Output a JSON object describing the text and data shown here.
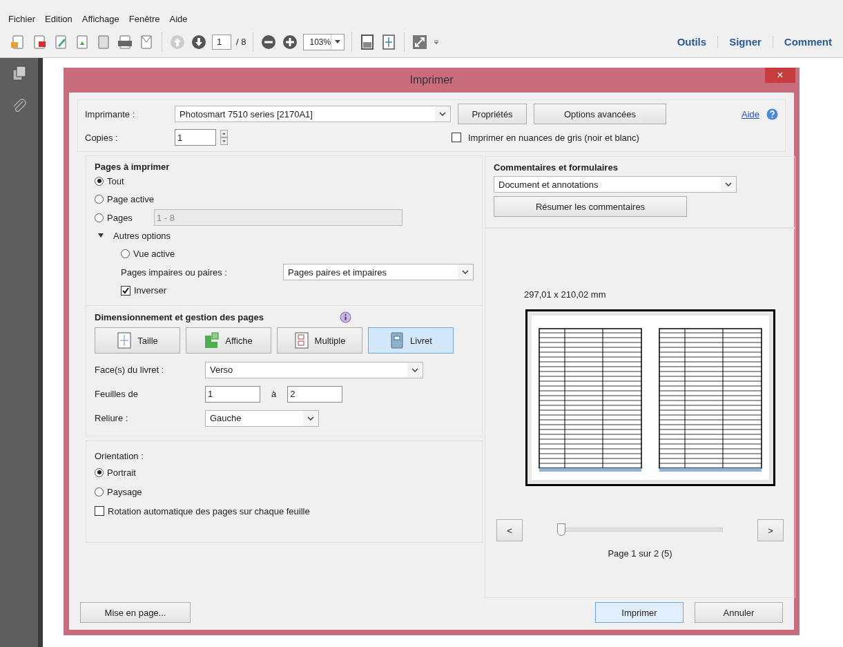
{
  "menu": [
    "Fichier",
    "Edition",
    "Affichage",
    "Fenêtre",
    "Aide"
  ],
  "toolbar": {
    "page_value": "1",
    "page_total": "/ 8",
    "zoom": "103%",
    "right_buttons": [
      "Outils",
      "Signer",
      "Comment"
    ]
  },
  "dialog": {
    "title": "Imprimer",
    "close": "×"
  },
  "printer": {
    "label": "Imprimante :",
    "value": "Photosmart 7510 series [2170A1]",
    "properties": "Propriétés",
    "advanced": "Options avancées",
    "help": "Aide"
  },
  "copies": {
    "label": "Copies :",
    "value": "1"
  },
  "grayscale": {
    "label": "Imprimer en nuances de gris (noir et blanc)",
    "checked": false
  },
  "pages": {
    "title": "Pages à imprimer",
    "options": [
      {
        "label": "Tout",
        "selected": true
      },
      {
        "label": "Page active",
        "selected": false
      },
      {
        "label": "Pages",
        "selected": false
      }
    ],
    "range": {
      "value": "1 - 8",
      "disabled": true
    },
    "more": {
      "label": "Autres options",
      "expanded": true
    },
    "current_view": {
      "label": "Vue active",
      "selected": false
    },
    "odd_even": {
      "label": "Pages impaires ou paires :",
      "value": "Pages paires et impaires"
    },
    "reverse": {
      "label": "Inverser",
      "checked": true
    }
  },
  "sizing": {
    "title": "Dimensionnement et gestion des pages",
    "buttons": [
      {
        "label": "Taille",
        "kind": "size",
        "selected": false
      },
      {
        "label": "Affiche",
        "kind": "poster",
        "selected": false
      },
      {
        "label": "Multiple",
        "kind": "multiple",
        "selected": false
      },
      {
        "label": "Livret",
        "kind": "booklet",
        "selected": true
      }
    ],
    "face": {
      "label": "Face(s) du livret :",
      "value": "Verso"
    },
    "sheets": {
      "label": "Feuilles de",
      "from": "1",
      "to_label": "à",
      "to": "2"
    },
    "binding": {
      "label": "Reliure :",
      "value": "Gauche"
    }
  },
  "orientation": {
    "title": "Orientation :",
    "options": [
      {
        "label": "Portrait",
        "selected": true
      },
      {
        "label": "Paysage",
        "selected": false
      }
    ],
    "auto_rotate": {
      "label": "Rotation automatique des pages sur chaque feuille",
      "checked": false
    }
  },
  "comments": {
    "title": "Commentaires et formulaires",
    "value": "Document et annotations",
    "summarize": "Résumer les commentaires"
  },
  "preview": {
    "size": "297,01 x 210,02 mm",
    "prev": "<",
    "next": ">",
    "slider": {
      "level": 0
    },
    "page_label": "Page 1 sur 2 (5)"
  },
  "footer": {
    "setup": "Mise en page...",
    "print": "Imprimer",
    "cancel": "Annuler"
  }
}
